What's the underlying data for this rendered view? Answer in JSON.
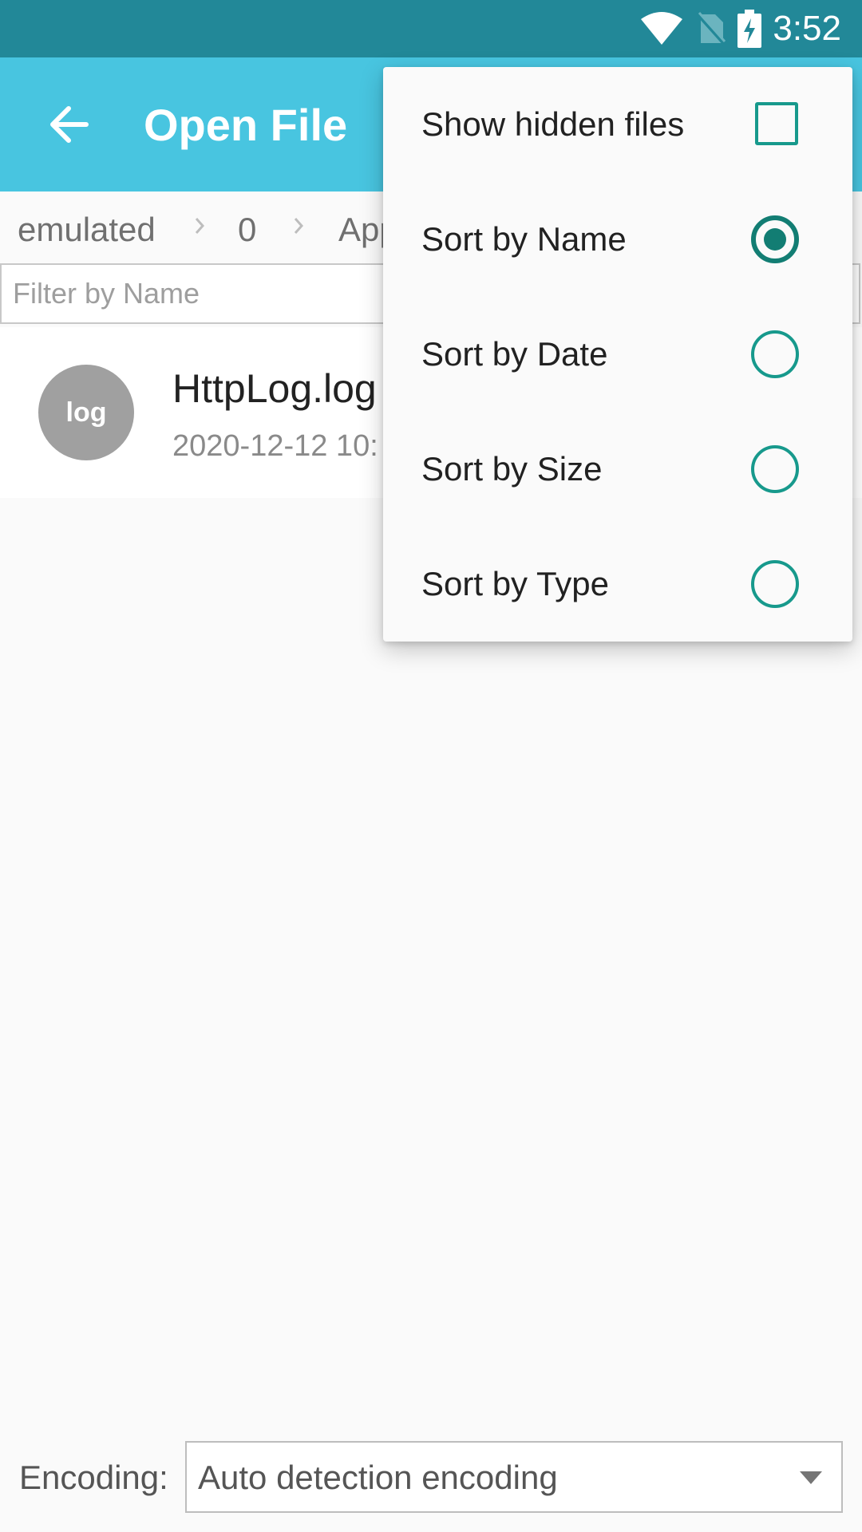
{
  "status_bar": {
    "time": "3:52",
    "icons": [
      "wifi-icon",
      "no-sim-icon",
      "battery-charging-icon"
    ]
  },
  "app_bar": {
    "title": "Open File",
    "back_icon": "arrow-back-icon"
  },
  "breadcrumb": {
    "items": [
      "emulated",
      "0",
      "App"
    ]
  },
  "filter": {
    "placeholder": "Filter by Name",
    "value": ""
  },
  "files": [
    {
      "avatar_text": "log",
      "name": "HttpLog.log",
      "meta": "2020-12-12 10:"
    }
  ],
  "encoding": {
    "label": "Encoding:",
    "value": "Auto detection encoding"
  },
  "menu": {
    "show_hidden": {
      "label": "Show hidden files",
      "checked": false
    },
    "sort_options": [
      {
        "label": "Sort by Name",
        "checked": true
      },
      {
        "label": "Sort by Date",
        "checked": false
      },
      {
        "label": "Sort by Size",
        "checked": false
      },
      {
        "label": "Sort by Type",
        "checked": false
      }
    ]
  },
  "colors": {
    "status_bar": "#228898",
    "app_bar": "#48c5e0",
    "accent": "#17998c",
    "avatar": "#a0a0a0"
  }
}
